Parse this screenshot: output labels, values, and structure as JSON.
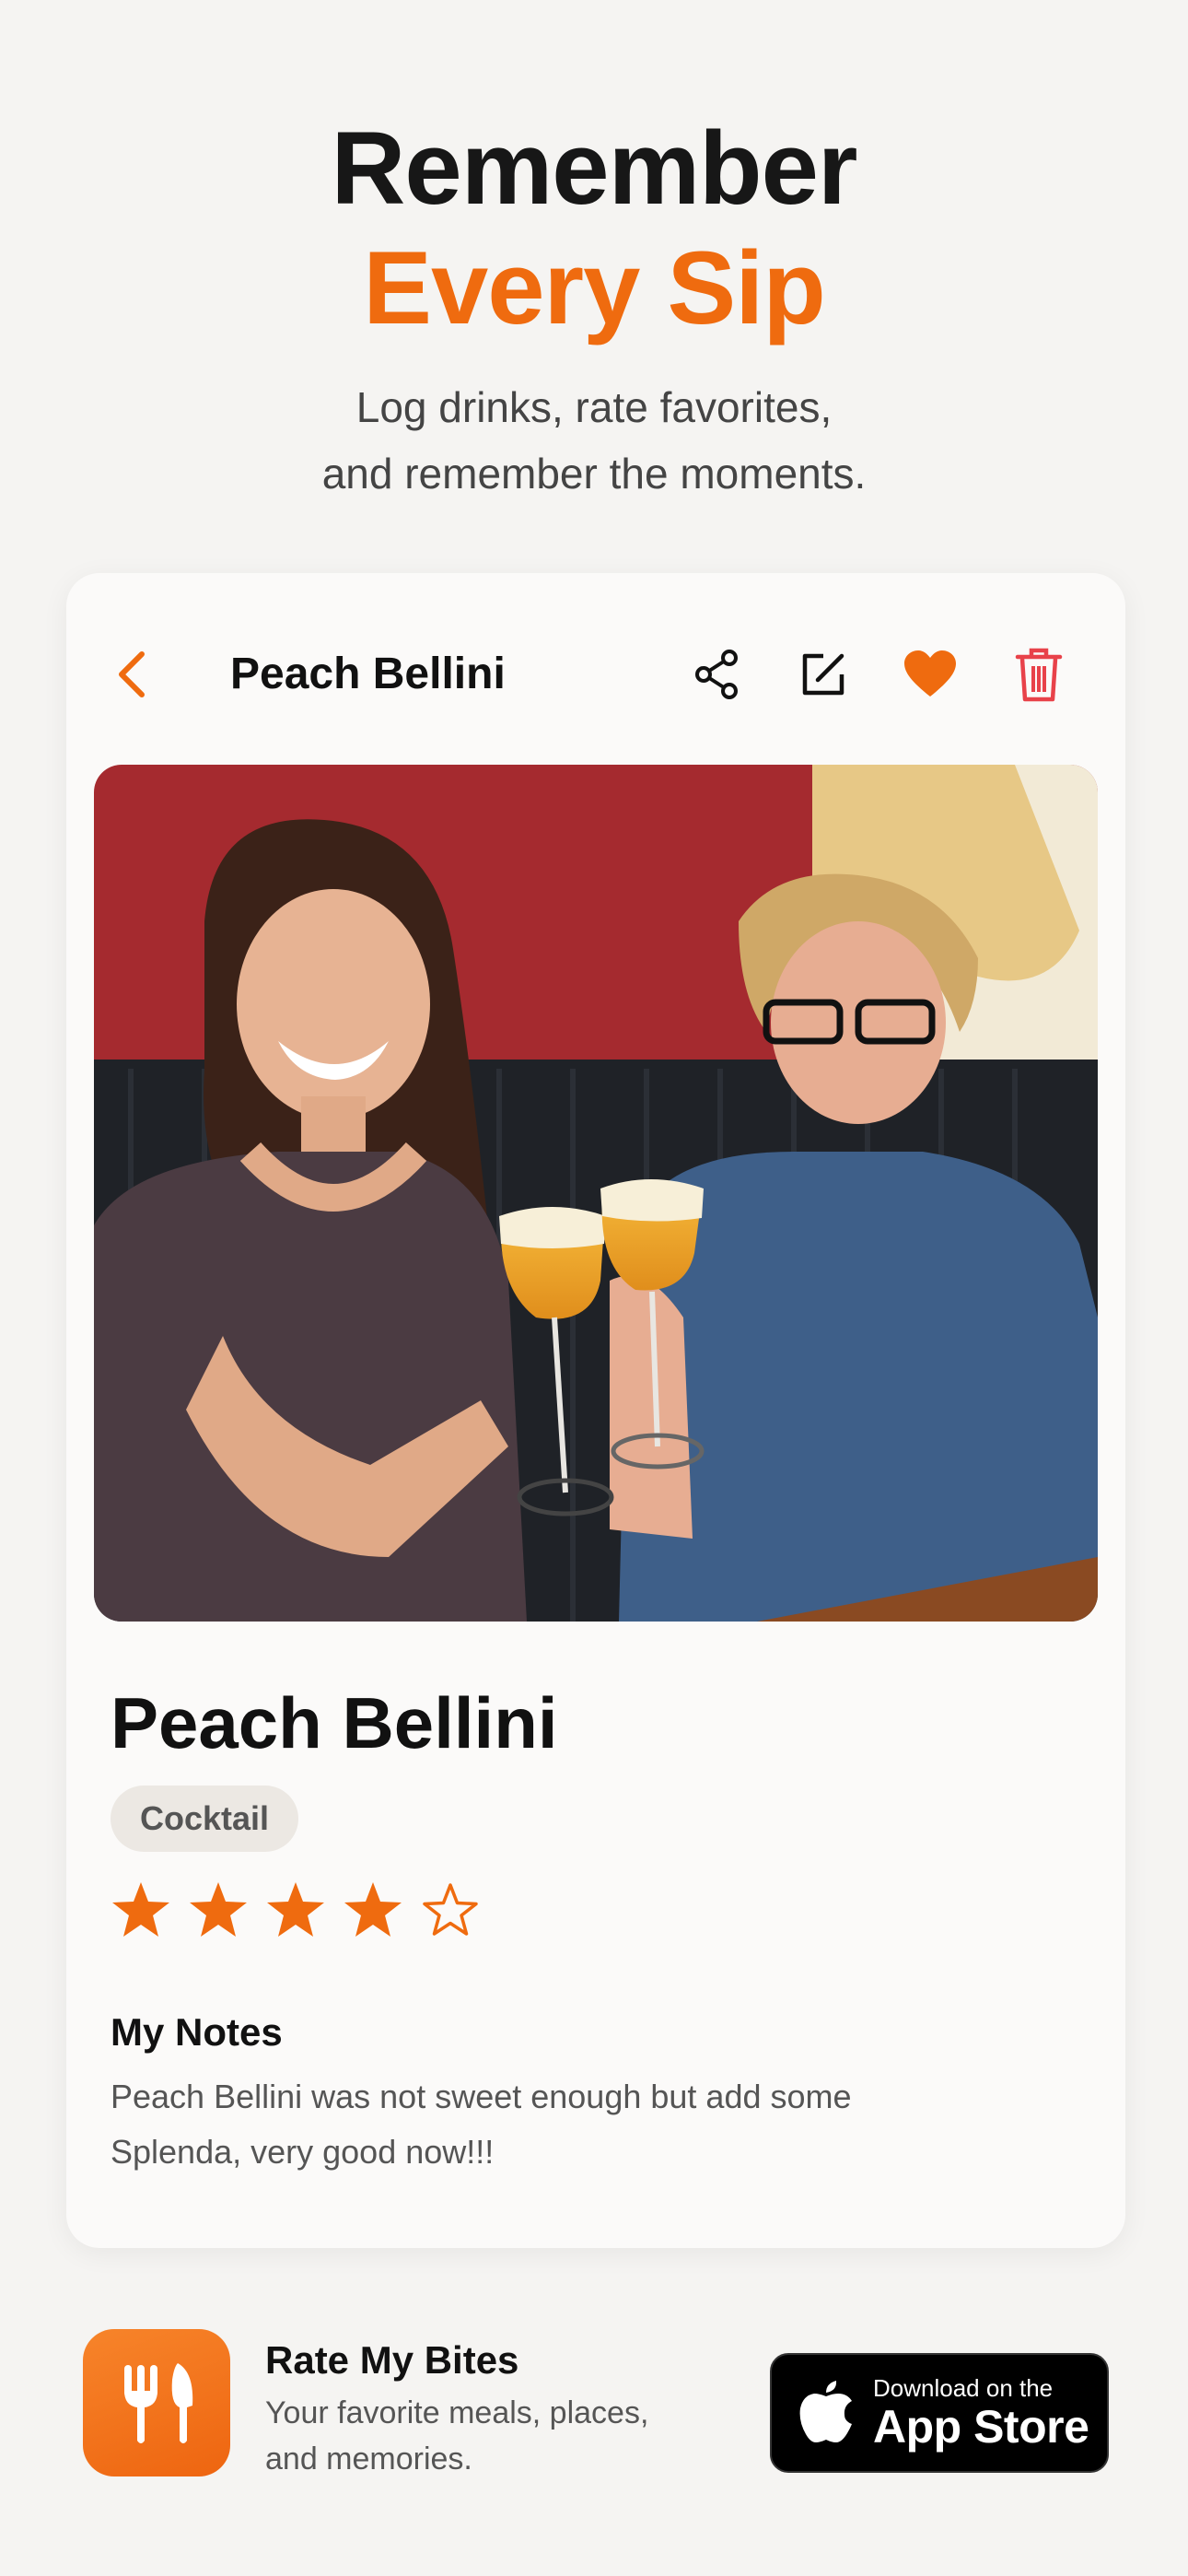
{
  "hero": {
    "title_line1": "Remember",
    "title_line2": "Every Sip",
    "subtitle_line1": "Log drinks, rate favorites,",
    "subtitle_line2": "and remember the moments."
  },
  "detail": {
    "header_title": "Peach Bellini",
    "icons": [
      "back-chevron-icon",
      "share-icon",
      "edit-icon",
      "heart-icon",
      "trash-icon"
    ],
    "drink_name": "Peach Bellini",
    "category": "Cocktail",
    "rating": 4,
    "rating_max": 5,
    "notes_title": "My Notes",
    "notes_line1": "Peach Bellini was not sweet enough but add some",
    "notes_line2": "Splenda, very good now!!!"
  },
  "footer": {
    "app_name": "Rate My Bites",
    "tagline_line1": "Your favorite meals, places,",
    "tagline_line2": "and memories.",
    "store_small": "Download on the",
    "store_big": "App Store"
  },
  "colors": {
    "accent": "#ef6b0f",
    "trash": "#e8424a",
    "background": "#f5f4f2"
  }
}
